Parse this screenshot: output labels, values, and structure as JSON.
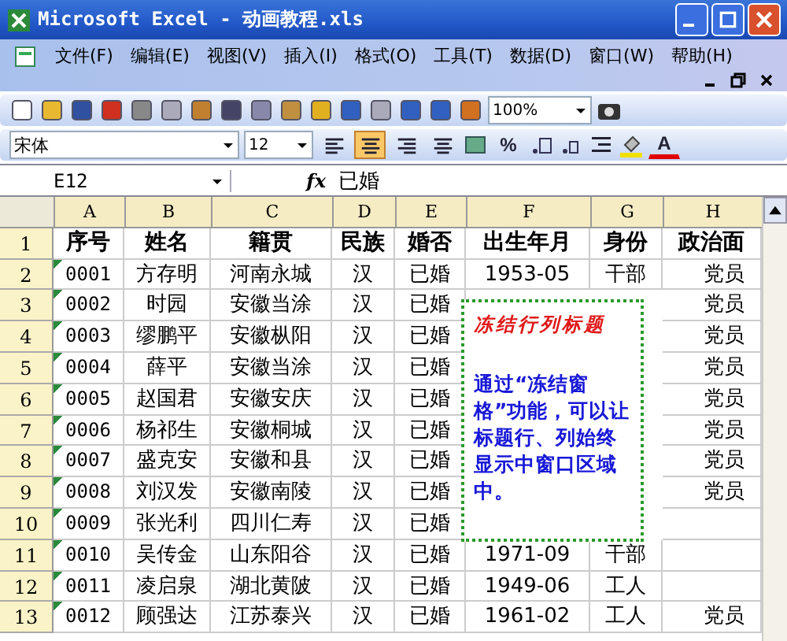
{
  "window": {
    "title": "Microsoft Excel - 动画教程.xls"
  },
  "menu": [
    "文件(F)",
    "编辑(E)",
    "视图(V)",
    "插入(I)",
    "格式(O)",
    "工具(T)",
    "数据(D)",
    "窗口(W)",
    "帮助(H)"
  ],
  "toolbar": {
    "zoom": "100%"
  },
  "format_bar": {
    "font": "宋体",
    "size": "12",
    "align_buttons": [
      {
        "pressed": false
      },
      {
        "pressed": true
      },
      {
        "pressed": false
      },
      {
        "pressed": false
      }
    ],
    "percent": "%",
    "font_color_glyph": "A"
  },
  "formula_bar": {
    "name_box": "E12",
    "fx": "fx",
    "value": "已婚"
  },
  "sheet": {
    "columns": [
      "A",
      "B",
      "C",
      "D",
      "E",
      "F",
      "G",
      "H"
    ],
    "rows": [
      {
        "number": "1",
        "kind": "header",
        "cells": [
          "序号",
          "姓名",
          "籍贯",
          "民族",
          "婚否",
          "出生年月",
          "身份",
          "政治面"
        ]
      },
      {
        "number": "2",
        "kind": "data",
        "cells": [
          "0001",
          "方存明",
          "河南永城",
          "汉",
          "已婚",
          "1953-05",
          "干部",
          "党员"
        ]
      },
      {
        "number": "3",
        "kind": "data",
        "cells": [
          "0002",
          "时园",
          "安徽当涂",
          "汉",
          "已婚",
          null,
          null,
          "党员"
        ]
      },
      {
        "number": "4",
        "kind": "data",
        "cells": [
          "0003",
          "缪鹏平",
          "安徽枞阳",
          "汉",
          "已婚",
          null,
          null,
          "党员"
        ]
      },
      {
        "number": "5",
        "kind": "data",
        "cells": [
          "0004",
          "薛平",
          "安徽当涂",
          "汉",
          "已婚",
          null,
          null,
          "党员"
        ]
      },
      {
        "number": "6",
        "kind": "data",
        "cells": [
          "0005",
          "赵国君",
          "安徽安庆",
          "汉",
          "已婚",
          null,
          null,
          "党员"
        ]
      },
      {
        "number": "7",
        "kind": "data",
        "cells": [
          "0006",
          "杨祁生",
          "安徽桐城",
          "汉",
          "已婚",
          null,
          null,
          "党员"
        ]
      },
      {
        "number": "8",
        "kind": "data",
        "cells": [
          "0007",
          "盛克安",
          "安徽和县",
          "汉",
          "已婚",
          null,
          null,
          "党员"
        ]
      },
      {
        "number": "9",
        "kind": "data",
        "cells": [
          "0008",
          "刘汉发",
          "安徽南陵",
          "汉",
          "已婚",
          null,
          null,
          "党员"
        ]
      },
      {
        "number": "10",
        "kind": "data",
        "cells": [
          "0009",
          "张光利",
          "四川仁寿",
          "汉",
          "已婚",
          null,
          null,
          null
        ]
      },
      {
        "number": "11",
        "kind": "data",
        "cells": [
          "0010",
          "吴传金",
          "山东阳谷",
          "汉",
          "已婚",
          "1971-09",
          "干部",
          null
        ]
      },
      {
        "number": "12",
        "kind": "data",
        "cells": [
          "0011",
          "凌启泉",
          "湖北黄陂",
          "汉",
          "已婚",
          "1949-06",
          "工人",
          null
        ]
      },
      {
        "number": "13",
        "kind": "data",
        "cells": [
          "0012",
          "顾强达",
          "江苏泰兴",
          "汉",
          "已婚",
          "1961-02",
          "工人",
          "党员"
        ]
      }
    ]
  },
  "callout": {
    "title": "冻结行列标题",
    "body": "通过“冻结窗格”功能，可以让标题行、列始终显示中窗口区域中。"
  }
}
